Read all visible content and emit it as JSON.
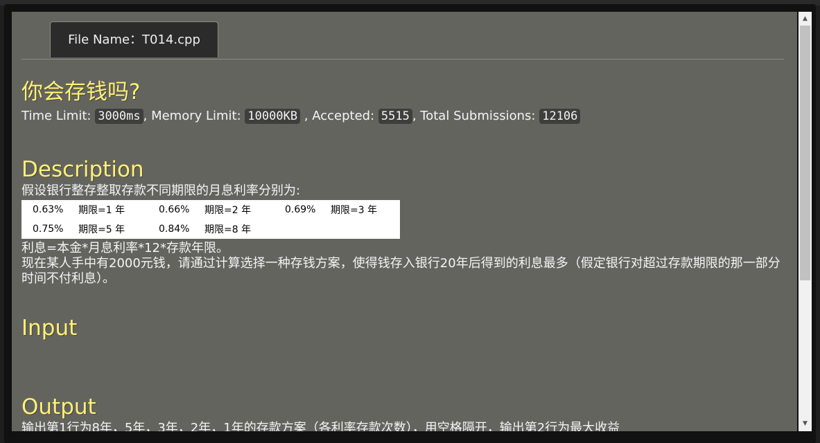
{
  "tab": {
    "label": "File Name：T014.cpp"
  },
  "problem": {
    "title": "你会存钱吗?",
    "meta": {
      "time_label": "Time Limit:",
      "time_value": "3000ms",
      "memory_label": ", Memory Limit:",
      "memory_value": "10000KB",
      "accepted_label": ", Accepted:",
      "accepted_value": "5515",
      "total_label": ", Total Submissions:",
      "total_value": "12106"
    }
  },
  "description": {
    "heading": "Description",
    "intro": "假设银行整存整取存款不同期限的月息利率分别为:",
    "rates": [
      [
        {
          "rate": "0.63%",
          "period": "期限=1 年"
        },
        {
          "rate": "0.66%",
          "period": "期限=2 年"
        },
        {
          "rate": "0.69%",
          "period": "期限=3 年"
        }
      ],
      [
        {
          "rate": "0.75%",
          "period": "期限=5 年"
        },
        {
          "rate": "0.84%",
          "period": "期限=8 年"
        }
      ]
    ],
    "formula": "利息=本金*月息利率*12*存款年限。",
    "task": "现在某人手中有2000元钱，请通过计算选择一种存钱方案，使得钱存入银行20年后得到的利息最多（假定银行对超过存款期限的那一部分时间不付利息）。"
  },
  "input": {
    "heading": "Input"
  },
  "output": {
    "heading": "Output",
    "first_line": "输出第1行为8年，5年，3年，2年，1年的存款方案（各利率存款次数），用空格隔开，输出第2行为最大收益"
  },
  "scrollbar": {
    "up_icon": "▲",
    "down_icon": "▼"
  }
}
